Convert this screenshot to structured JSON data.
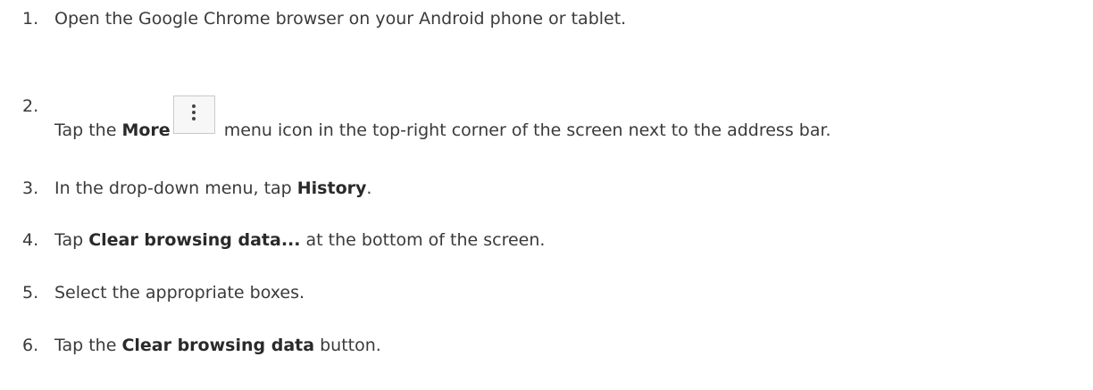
{
  "steps": [
    {
      "number": "1.",
      "text": "Open the Google Chrome browser on your Android phone or tablet."
    },
    {
      "number": "2.",
      "prefix": "Tap the ",
      "bold": "More",
      "icon": "more-vert-icon",
      "suffix": " menu icon in the top-right corner of the screen next to the address bar."
    },
    {
      "number": "3.",
      "prefix": "In the drop-down menu, tap ",
      "bold": "History",
      "suffix": "."
    },
    {
      "number": "4.",
      "prefix": "Tap ",
      "bold": "Clear browsing data...",
      "suffix": " at the bottom of the screen."
    },
    {
      "number": "5.",
      "text": "Select the appropriate boxes."
    },
    {
      "number": "6.",
      "prefix": "Tap the ",
      "bold": "Clear browsing data",
      "suffix": " button."
    }
  ]
}
